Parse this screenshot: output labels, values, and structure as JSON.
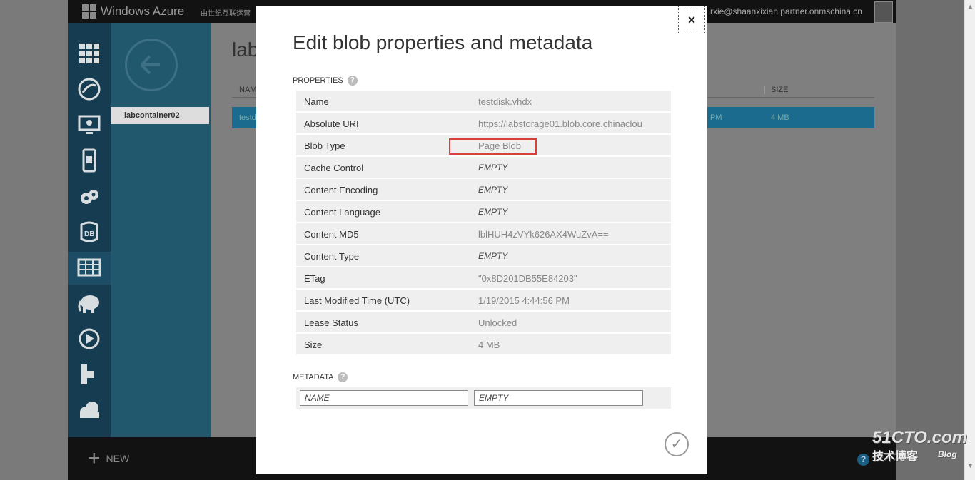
{
  "topbar": {
    "product": "Windows Azure",
    "partner": "由世纪互联运营",
    "user": "rxie@shaanxixian.partner.onmschina.cn"
  },
  "sidebar": {
    "container": "labcontainer02"
  },
  "main": {
    "title": "lab",
    "col_name": "NAM",
    "col_size": "SIZE",
    "row_name": "testd",
    "row_time": "PM",
    "row_size": "4 MB"
  },
  "bottombar": {
    "new_label": "NEW"
  },
  "modal": {
    "title": "Edit blob properties and metadata",
    "properties_heading": "PROPERTIES",
    "metadata_heading": "METADATA",
    "close_label": "×",
    "properties": [
      {
        "key": "Name",
        "value": "testdisk.vhdx",
        "empty": false
      },
      {
        "key": "Absolute URI",
        "value": "https://labstorage01.blob.core.chinaclou",
        "empty": false
      },
      {
        "key": "Blob Type",
        "value": "Page Blob",
        "empty": false
      },
      {
        "key": "Cache Control",
        "value": "EMPTY",
        "empty": true
      },
      {
        "key": "Content Encoding",
        "value": "EMPTY",
        "empty": true
      },
      {
        "key": "Content Language",
        "value": "EMPTY",
        "empty": true
      },
      {
        "key": "Content MD5",
        "value": "lblHUH4zVYk626AX4WuZvA==",
        "empty": false
      },
      {
        "key": "Content Type",
        "value": "EMPTY",
        "empty": true
      },
      {
        "key": "ETag",
        "value": "\"0x8D201DB55E84203\"",
        "empty": false
      },
      {
        "key": "Last Modified Time (UTC)",
        "value": "1/19/2015 4:44:56 PM",
        "empty": false
      },
      {
        "key": "Lease Status",
        "value": "Unlocked",
        "empty": false
      },
      {
        "key": "Size",
        "value": "4 MB",
        "empty": false
      }
    ],
    "metadata": {
      "name_placeholder": "NAME",
      "value_placeholder": "EMPTY"
    }
  },
  "watermark": {
    "line1": "51CTO.com",
    "line2": "技术博客",
    "line3": "Blog"
  },
  "colors": {
    "nav_bg": "#163c51",
    "panel_bg": "#21586e",
    "row_selected": "#1a6b8e",
    "highlight": "#d9403c"
  }
}
